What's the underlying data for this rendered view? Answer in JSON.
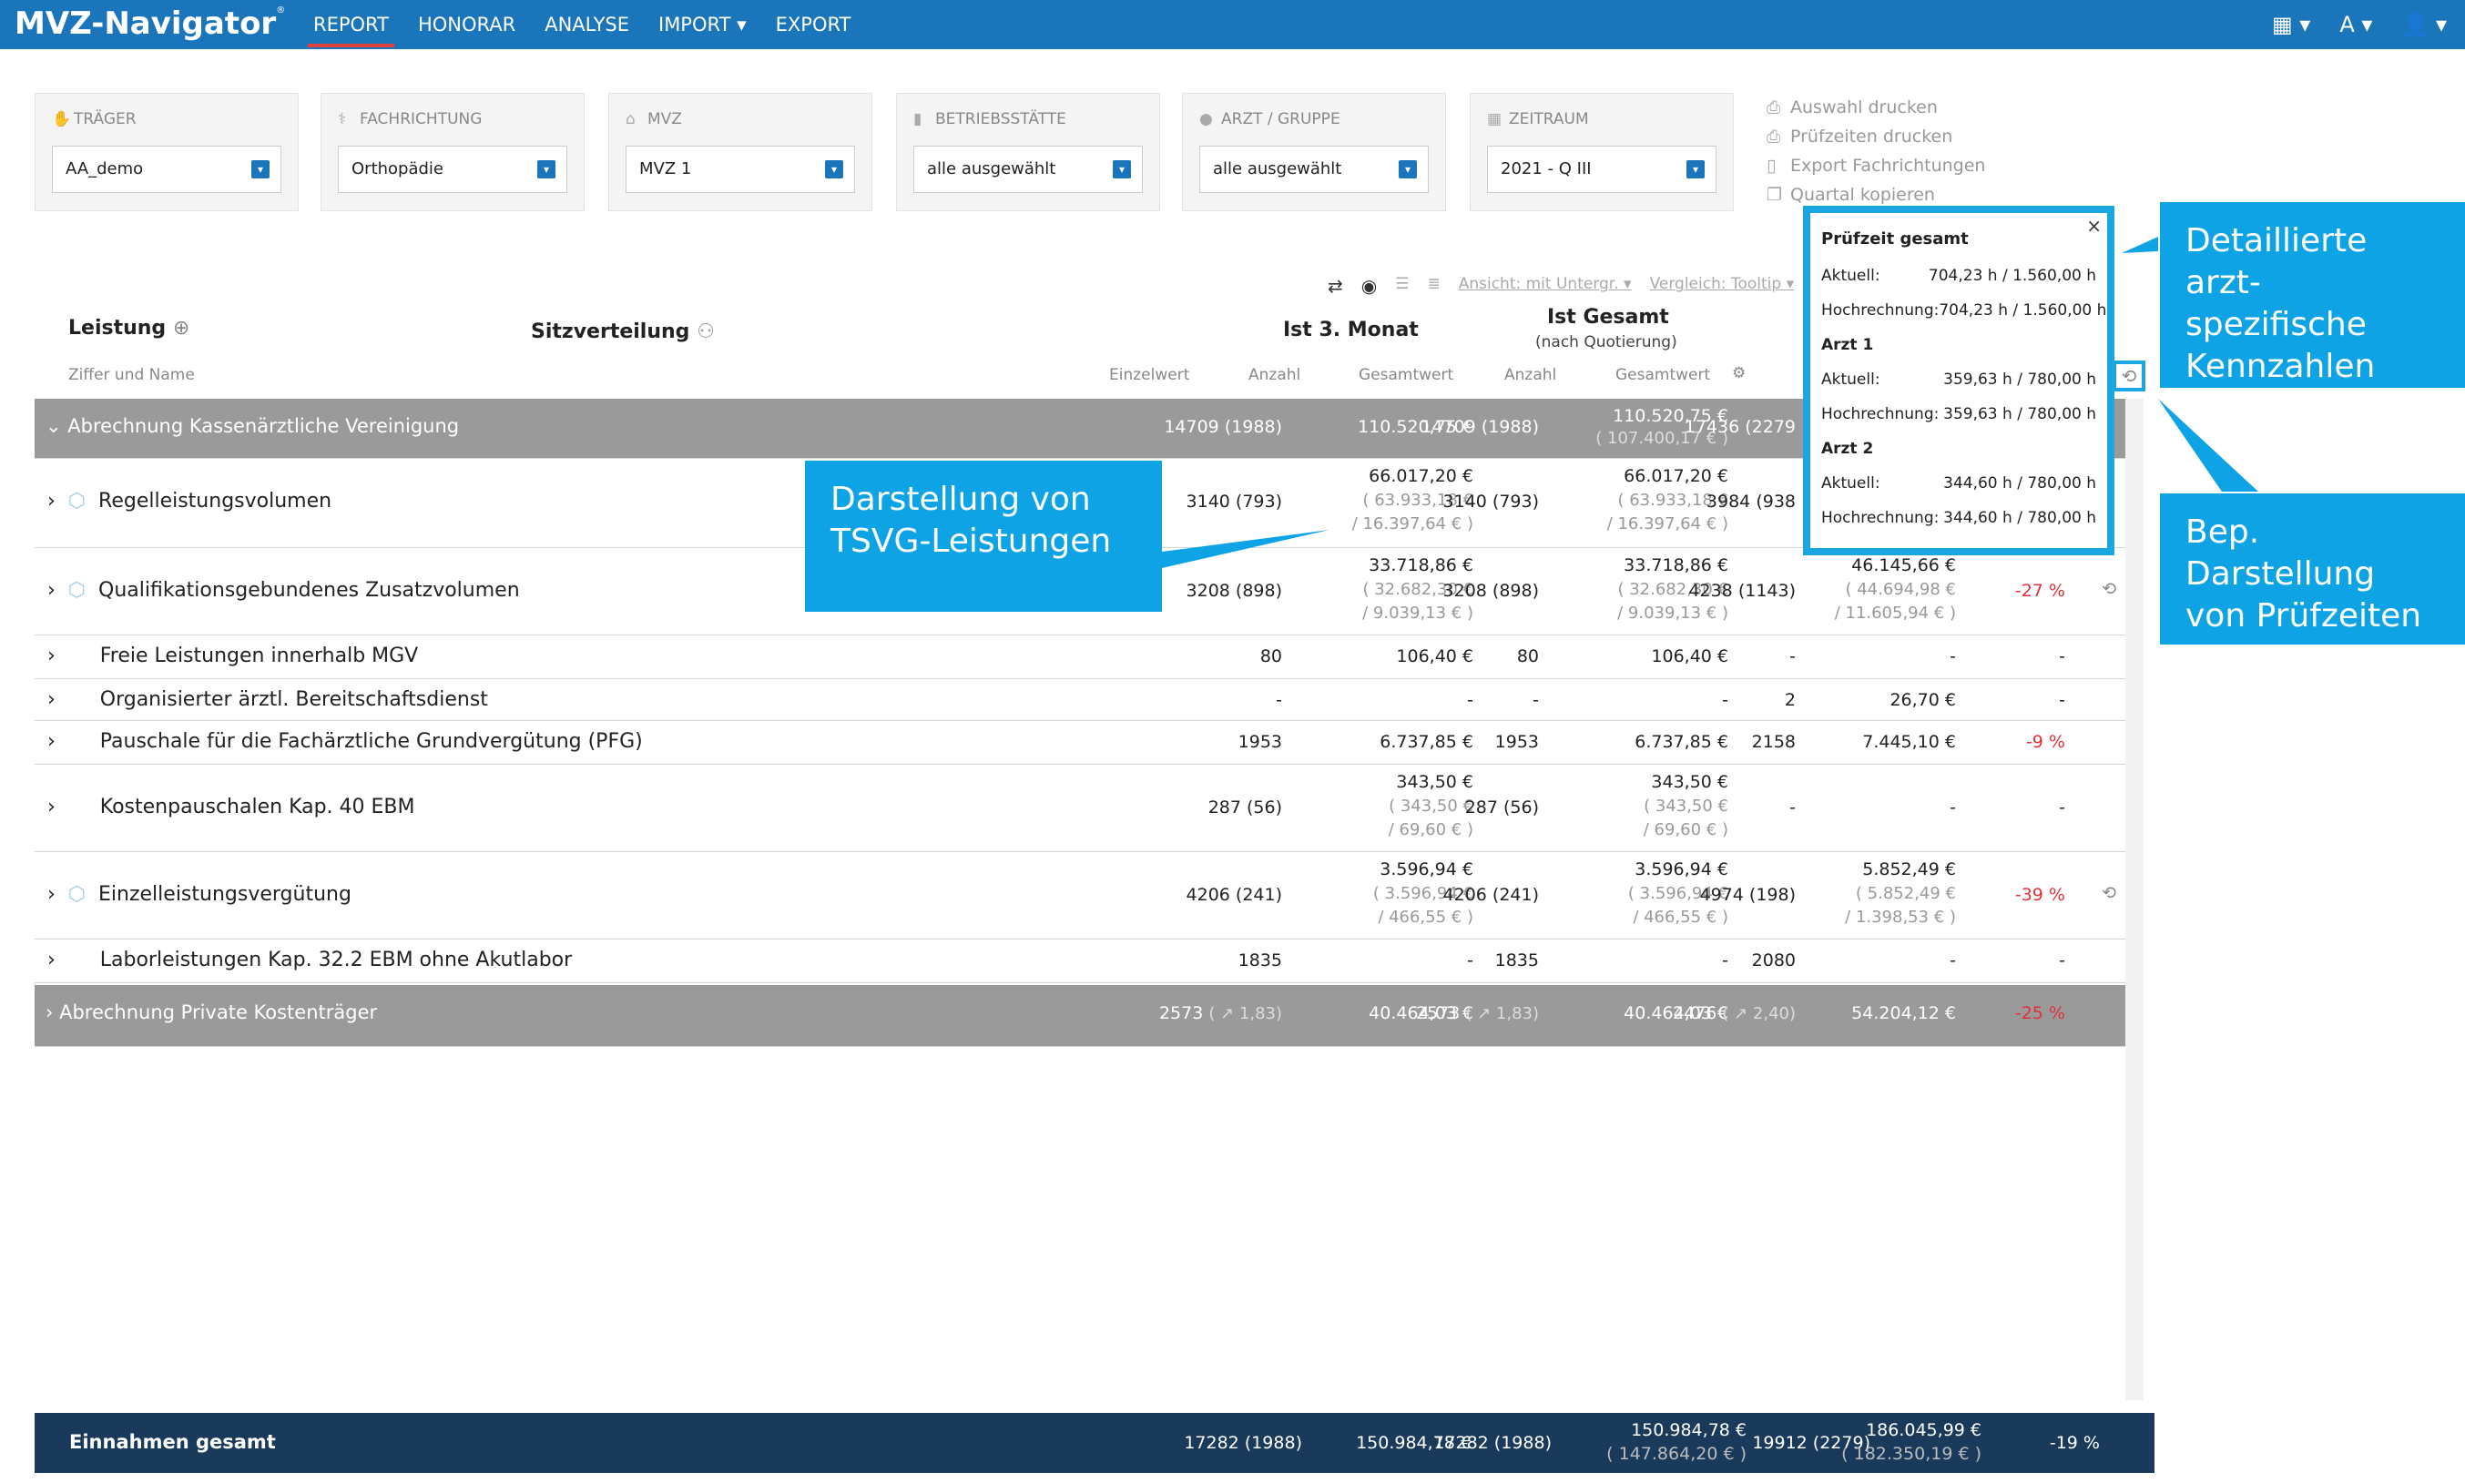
{
  "app": {
    "logo": "MVZ-Navigator",
    "logo_reg": "®"
  },
  "nav": {
    "items": [
      {
        "label": "REPORT"
      },
      {
        "label": "HONORAR"
      },
      {
        "label": "ANALYSE"
      },
      {
        "label": "IMPORT ▾"
      },
      {
        "label": "EXPORT"
      }
    ],
    "right": {
      "table_icon": "▦ ▾",
      "font_icon": "A ▾",
      "user_icon": "👤 ▾"
    }
  },
  "filters": [
    {
      "label": "TRÄGER",
      "value": "AA_demo",
      "icon": "handshake-icon"
    },
    {
      "label": "FACHRICHTUNG",
      "value": "Orthopädie",
      "icon": "stethoscope-icon"
    },
    {
      "label": "MVZ",
      "value": "MVZ 1",
      "icon": "building-icon"
    },
    {
      "label": "BETRIEBSSTÄTTE",
      "value": "alle ausgewählt",
      "icon": "office-icon"
    },
    {
      "label": "ARZT / GRUPPE",
      "value": "alle ausgewählt",
      "icon": "person-icon"
    },
    {
      "label": "ZEITRAUM",
      "value": "2021 - Q III",
      "icon": "calendar-icon"
    }
  ],
  "actions": [
    "Auswahl drucken",
    "Prüfzeiten drucken",
    "Export Fachrichtungen",
    "Quartal kopieren"
  ],
  "toolbar": {
    "view": "Ansicht: mit Untergr.",
    "compare": "Vergleich: Tooltip"
  },
  "headers": {
    "leistung": "Leistung",
    "leistung_sub": "Ziffer und Name",
    "sitzverteilung": "Sitzverteilung",
    "ist_monat": "Ist 3. Monat",
    "ist_gesamt": "Ist Gesamt",
    "ist_gesamt_sub": "(nach Quotierung)",
    "einzelwert": "Einzelwert",
    "anzahl1": "Anzahl",
    "gesamtwert1": "Gesamtwert",
    "anzahl2": "Anzahl",
    "gesamtwert2": "Gesamtwert"
  },
  "rows": [
    {
      "name": "Abrechnung Kassenärztliche Vereinigung",
      "c1": "14709 (1988)",
      "c2": "110.520,75 €",
      "c3": "14709 (1988)",
      "c4a": "110.520,75 €",
      "c4b": "( 107.400,17 € )",
      "c5": "17436 (2279",
      "c6": "",
      "c7": ""
    },
    {
      "name": "Regelleistungsvolumen",
      "c1": "3140 (793)",
      "c2a": "66.017,20 €",
      "c2b": "( 63.933,18 €",
      "c2c": "/ 16.397,64 € )",
      "c3": "3140 (793)",
      "c4a": "66.017,20 €",
      "c4b": "( 63.933,18 €",
      "c4c": "/ 16.397,64 € )",
      "c5": "3984 (938",
      "c6": "",
      "c7": ""
    },
    {
      "name": "Qualifikationsgebundenes Zusatzvolumen",
      "c1": "3208 (898)",
      "c2a": "33.718,86 €",
      "c2b": "( 32.682,30 €",
      "c2c": "/ 9.039,13 € )",
      "c3": "3208 (898)",
      "c4a": "33.718,86 €",
      "c4b": "( 32.682,30 €",
      "c4c": "/ 9.039,13 € )",
      "c5": "4238 (1143)",
      "c6a": "46.145,66 €",
      "c6b": "( 44.694,98 €",
      "c6c": "/ 11.605,94 € )",
      "c7": "-27 %"
    },
    {
      "name": "Freie Leistungen innerhalb MGV",
      "c1": "80",
      "c2": "106,40 €",
      "c3": "80",
      "c4": "106,40 €",
      "c5": "-",
      "c6": "-",
      "c7": "-"
    },
    {
      "name": "Organisierter ärztl. Bereitschaftsdienst",
      "c0": "-",
      "c1": "-",
      "c2": "-",
      "c3": "-",
      "c4": "-",
      "c5": "2",
      "c6": "26,70 €",
      "c7": "-"
    },
    {
      "name": "Pauschale für die Fachärztliche Grundvergütung (PFG)",
      "c1": "1953",
      "c2": "6.737,85 €",
      "c3": "1953",
      "c4": "6.737,85 €",
      "c5": "2158",
      "c6": "7.445,10 €",
      "c7": "-9 %"
    },
    {
      "name": "Kostenpauschalen Kap. 40 EBM",
      "c1": "287 (56)",
      "c2a": "343,50 €",
      "c2b": "( 343,50 €",
      "c2c": "/ 69,60 € )",
      "c3": "287 (56)",
      "c4a": "343,50 €",
      "c4b": "( 343,50 €",
      "c4c": "/ 69,60 € )",
      "c5": "-",
      "c6": "-",
      "c7": "-"
    },
    {
      "name": "Einzelleistungsvergütung",
      "c1": "4206 (241)",
      "c2a": "3.596,94 €",
      "c2b": "( 3.596,94 €",
      "c2c": "/ 466,55 € )",
      "c3": "4206 (241)",
      "c4a": "3.596,94 €",
      "c4b": "( 3.596,94 €",
      "c4c": "/ 466,55 € )",
      "c5": "4974 (198)",
      "c6a": "5.852,49 €",
      "c6b": "( 5.852,49 €",
      "c6c": "/ 1.398,53 € )",
      "c7": "-39 %"
    },
    {
      "name": "Laborleistungen Kap. 32.2 EBM ohne Akutlabor",
      "c1": "1835",
      "c2": "-",
      "c3": "1835",
      "c4": "-",
      "c5": "2080",
      "c6": "-",
      "c7": "-"
    },
    {
      "name": "Abrechnung Private Kostenträger",
      "c1": "2573",
      "c1s": "( ↗ 1,83)",
      "c2": "40.464,03 €",
      "c3": "2573",
      "c3s": "( ↗ 1,83)",
      "c4": "40.464,03 €",
      "c5": "2476",
      "c5s": "( ↗ 2,40)",
      "c6": "54.204,12 €",
      "c7": "-25 %"
    }
  ],
  "footer": {
    "label": "Einnahmen gesamt",
    "c1": "17282 (1988)",
    "c2": "150.984,78 €",
    "c3": "17282 (1988)",
    "c4a": "150.984,78 €",
    "c4b": "( 147.864,20 € )",
    "c5": "19912 (2279)",
    "c6a": "186.045,99 €",
    "c6b": "( 182.350,19 € )",
    "c7": "-19 %"
  },
  "popover": {
    "title": "Prüfzeit gesamt",
    "close": "×",
    "lines": [
      {
        "k": "Aktuell:",
        "v": "704,23 h / 1.560,00 h"
      },
      {
        "k": "Hochrechnung:",
        "v": "704,23 h / 1.560,00 h"
      }
    ],
    "arzt1": "Arzt 1",
    "arzt1_lines": [
      {
        "k": "Aktuell:",
        "v": "359,63 h / 780,00 h"
      },
      {
        "k": "Hochrechnung:",
        "v": "359,63 h / 780,00 h"
      }
    ],
    "arzt2": "Arzt 2",
    "arzt2_lines": [
      {
        "k": "Aktuell:",
        "v": "344,60 h / 780,00 h"
      },
      {
        "k": "Hochrechnung:",
        "v": "344,60 h / 780,00 h"
      }
    ]
  },
  "callouts": {
    "tsvg": "Darstellung von TSVG-Leistungen",
    "detail": "Detaillierte arzt-spezifische Kennzahlen",
    "pruef": "Bep. Darstellung von Prüfzeiten"
  },
  "colors": {
    "brand": "#1a75bb",
    "accent": "#0ea3e4",
    "negative": "#e0303a",
    "group_row": "#9a9a9a",
    "footer": "#1a3a5c"
  }
}
